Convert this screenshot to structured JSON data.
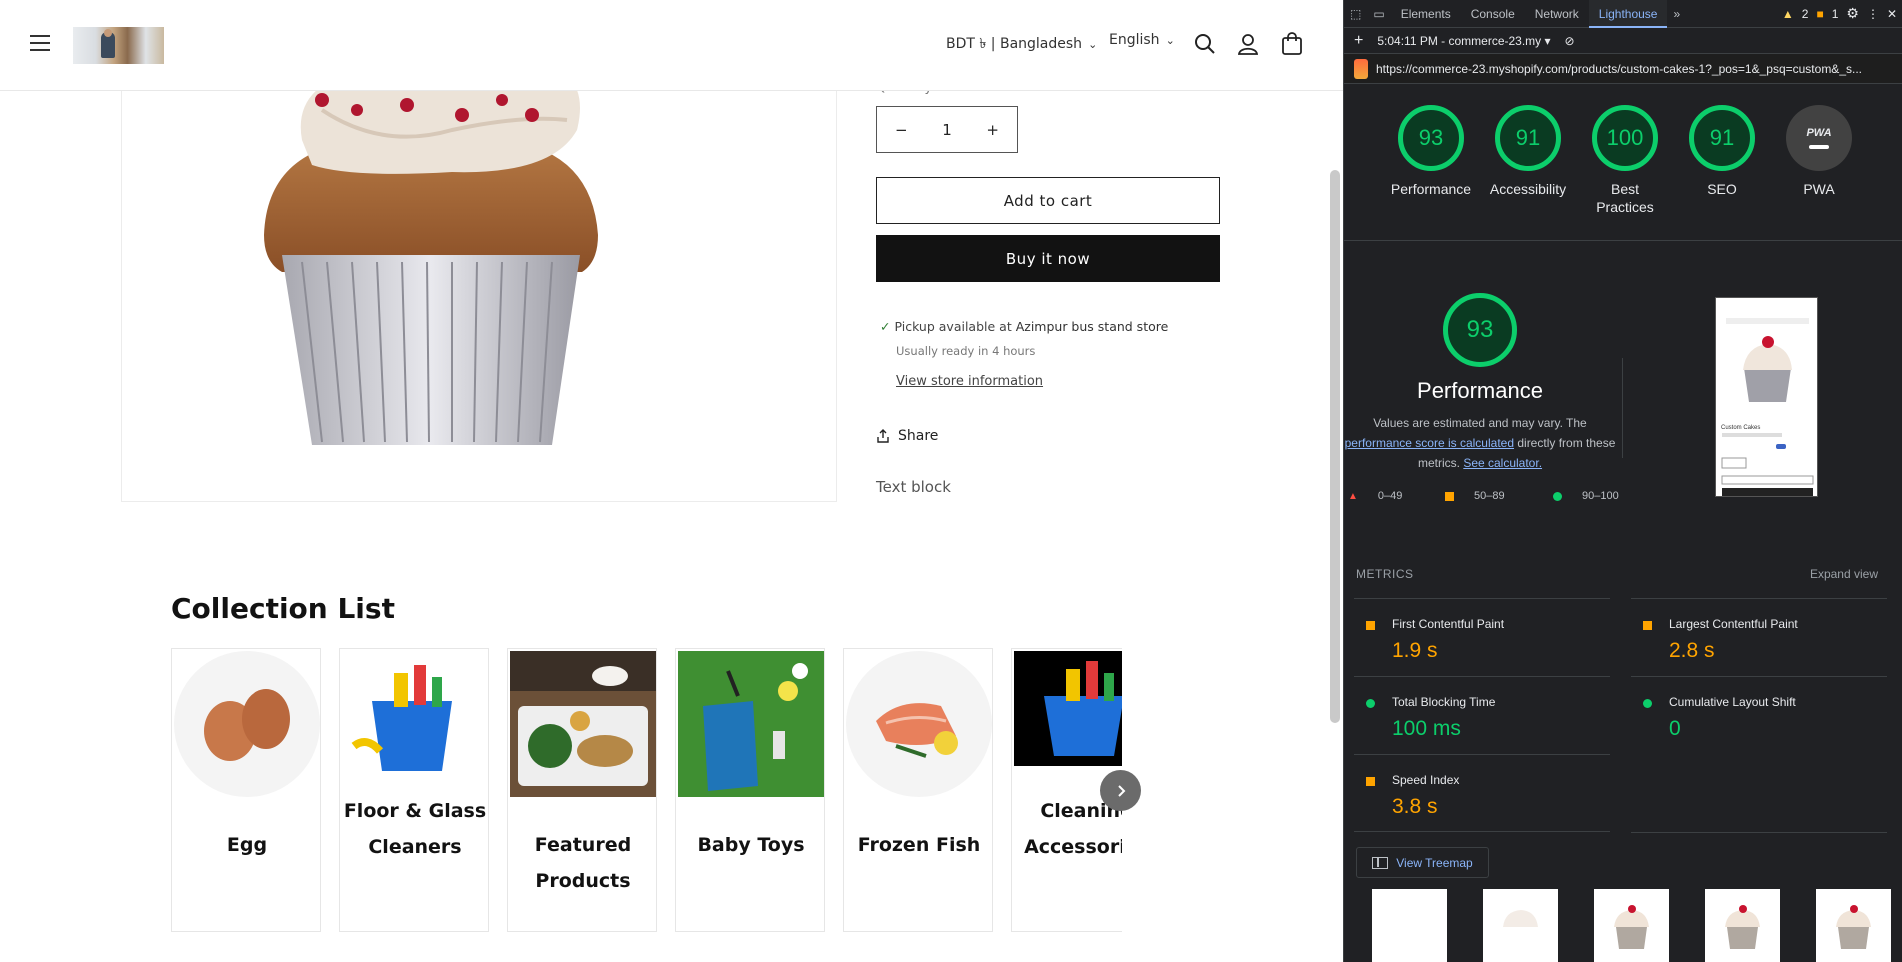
{
  "store": {
    "currency": "BDT ৳ | Bangladesh",
    "language": "English",
    "quantity_label": "Quantity",
    "quantity_value": "1",
    "qty_minus": "−",
    "qty_plus": "+",
    "add_to_cart": "Add to cart",
    "buy_now": "Buy it now",
    "pickup": {
      "prefix": "Pickup available at ",
      "location": "Azimpur bus stand store",
      "ready": "Usually ready in 4 hours",
      "link": "View store information"
    },
    "share": "Share",
    "text_block": "Text block",
    "collection_title": "Collection List",
    "collections": [
      {
        "name1": "Egg",
        "name2": ""
      },
      {
        "name1": "Floor & Glass",
        "name2": "Cleaners"
      },
      {
        "name1": "Featured",
        "name2": "Products"
      },
      {
        "name1": "Baby Toys",
        "name2": ""
      },
      {
        "name1": "Frozen Fish",
        "name2": ""
      },
      {
        "name1": "Cleaning",
        "name2": "Accessories"
      }
    ]
  },
  "devtools": {
    "tabs": [
      "Elements",
      "Console",
      "Network",
      "Lighthouse"
    ],
    "active_tab": "Lighthouse",
    "warnings": "2",
    "issues": "1",
    "report_time": "5:04:11 PM - commerce-23.my",
    "url": "https://commerce-23.myshopify.com/products/custom-cakes-1?_pos=1&_psq=custom&_s...",
    "scores": [
      {
        "value": "93",
        "label": "Performance"
      },
      {
        "value": "91",
        "label": "Accessibility"
      },
      {
        "value": "100",
        "label": "Best Practices"
      },
      {
        "value": "91",
        "label": "SEO"
      },
      {
        "value": "PWA",
        "label": "PWA"
      }
    ],
    "performance": {
      "score": "93",
      "title": "Performance",
      "note1": "Values are estimated and may vary. The",
      "note_link1": "performance score is calculated",
      "note2": " directly from these",
      "note3": "metrics. ",
      "note_link2": "See calculator.",
      "legend": [
        "0–49",
        "50–89",
        "90–100"
      ]
    },
    "metrics_label": "METRICS",
    "expand_view": "Expand view",
    "metrics": [
      {
        "name": "First Contentful Paint",
        "value": "1.9 s",
        "status": "average"
      },
      {
        "name": "Largest Contentful Paint",
        "value": "2.8 s",
        "status": "average"
      },
      {
        "name": "Total Blocking Time",
        "value": "100 ms",
        "status": "good"
      },
      {
        "name": "Cumulative Layout Shift",
        "value": "0",
        "status": "good"
      },
      {
        "name": "Speed Index",
        "value": "3.8 s",
        "status": "average"
      }
    ],
    "view_treemap": "View Treemap",
    "screenshot_caption": "Custom Cakes"
  },
  "colors": {
    "good": "#0cce6b",
    "average": "#ffa400",
    "poor": "#ff4e42",
    "devtools_bg": "#202124",
    "link": "#8ab4f8"
  }
}
